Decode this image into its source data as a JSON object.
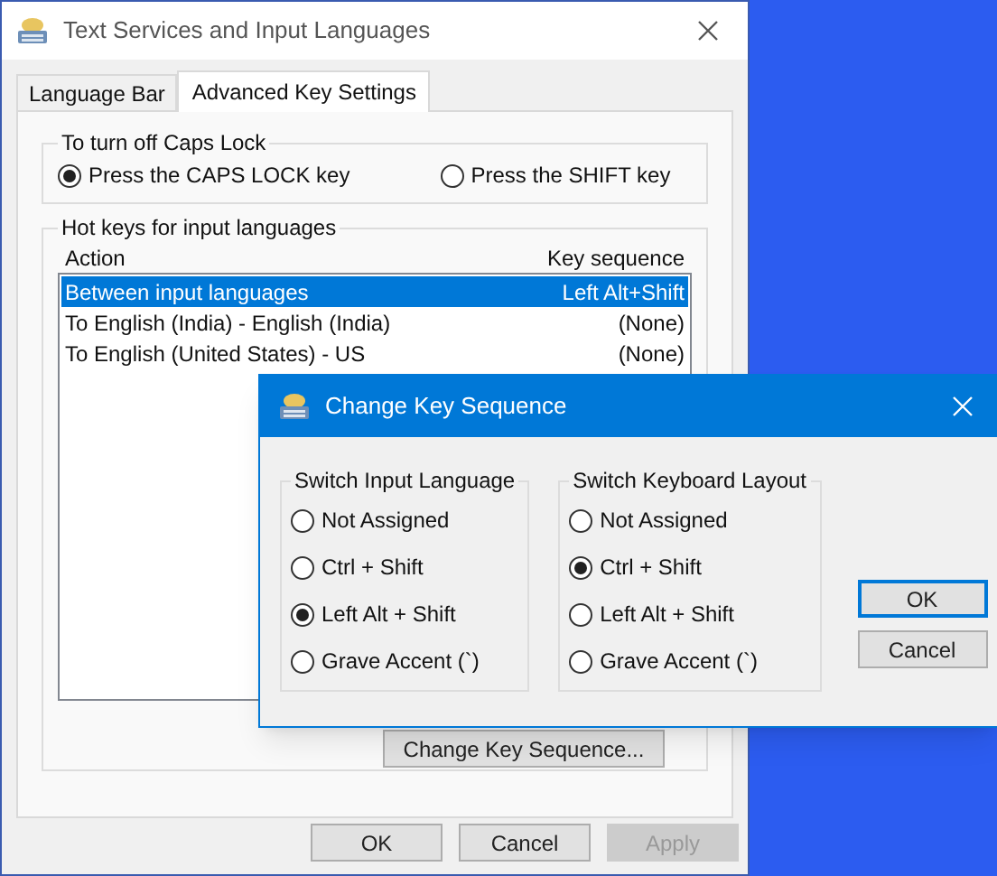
{
  "window": {
    "title": "Text Services and Input Languages"
  },
  "tabs": [
    {
      "label": "Language Bar",
      "selected": false
    },
    {
      "label": "Advanced Key Settings",
      "selected": true
    }
  ],
  "caps_lock": {
    "title": "To turn off Caps Lock",
    "options": [
      {
        "label": "Press the CAPS LOCK key",
        "selected": true
      },
      {
        "label": "Press the SHIFT key",
        "selected": false
      }
    ]
  },
  "hot_keys": {
    "title": "Hot keys for input languages",
    "columns": [
      "Action",
      "Key sequence"
    ],
    "rows": [
      {
        "action": "Between input languages",
        "key_sequence": "Left Alt+Shift",
        "selected": true
      },
      {
        "action": "To English (India) - English (India)",
        "key_sequence": "(None)",
        "selected": false
      },
      {
        "action": "To English (United States) - US",
        "key_sequence": "(None)",
        "selected": false
      }
    ],
    "button": "Change Key Sequence..."
  },
  "buttons": [
    {
      "label": "OK",
      "disabled": false
    },
    {
      "label": "Cancel",
      "disabled": false
    },
    {
      "label": "Apply",
      "disabled": true
    }
  ],
  "dialog": {
    "title": "Change Key Sequence",
    "groups": [
      {
        "title": "Switch Input Language",
        "options": [
          {
            "label": "Not Assigned",
            "selected": false
          },
          {
            "label": "Ctrl + Shift",
            "selected": false
          },
          {
            "label": "Left Alt + Shift",
            "selected": true
          },
          {
            "label": "Grave Accent (`)",
            "selected": false
          }
        ]
      },
      {
        "title": "Switch Keyboard Layout",
        "options": [
          {
            "label": "Not Assigned",
            "selected": false
          },
          {
            "label": "Ctrl + Shift",
            "selected": true
          },
          {
            "label": "Left Alt + Shift",
            "selected": false
          },
          {
            "label": "Grave Accent (`)",
            "selected": false
          }
        ]
      }
    ],
    "buttons": [
      {
        "label": "OK",
        "default": true
      },
      {
        "label": "Cancel",
        "default": false
      }
    ]
  }
}
